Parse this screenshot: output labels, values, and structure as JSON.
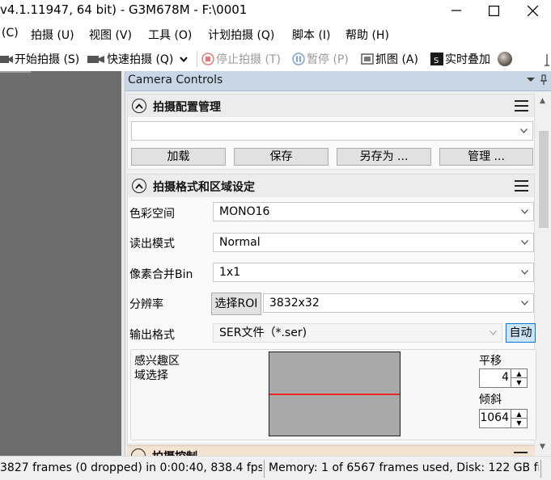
{
  "window": {
    "title": "v4.1.11947, 64 bit) - G3M678M - F:\\0001",
    "controls": [
      "minimize",
      "maximize",
      "close"
    ]
  },
  "menu": [
    "(C)",
    "拍摄 (U)",
    "视图 (V)",
    "工具 (O)",
    "计划拍摄 (Q)",
    "脚本 (I)",
    "帮助 (H)"
  ],
  "toolbar": {
    "start_capture": "开始拍摄 (S)",
    "quick_capture": "快速拍摄 (Q)",
    "stop_capture": "停止拍摄 (T)",
    "pause": "暂停 (P)",
    "grab": "抓图 (A)",
    "live_stack": "实时叠加"
  },
  "panel": {
    "title": "Camera Controls",
    "profile_section": {
      "title": "拍摄配置管理",
      "profile_value": "",
      "buttons": [
        "加载",
        "保存",
        "另存为 ...",
        "管理 ..."
      ]
    },
    "format_section": {
      "title": "拍摄格式和区域设定",
      "color_space_label": "色彩空间",
      "color_space_value": "MONO16",
      "readout_label": "读出模式",
      "readout_value": "Normal",
      "binning_label": "像素合并Bin",
      "binning_value": "1x1",
      "resolution_label": "分辨率",
      "roi_button": "选择ROI",
      "resolution_value": "3832x32",
      "output_label": "输出格式",
      "output_value": "SER文件（*.ser)",
      "auto_button": "自动",
      "roi_label_line1": "感兴趣区",
      "roi_label_line2": "域选择",
      "pan_label": "平移",
      "pan_value": "4",
      "tilt_label": "倾斜",
      "tilt_value": "1064"
    },
    "next_section_title": "拍摄控制"
  },
  "status": {
    "frames": "3827 frames (0 dropped) in 0:00:40, 838.4 fps",
    "memory": "Memory: 1 of 6567 frames used, Disk: 122 GB fr"
  },
  "colors": {
    "panel_header": "#c9d6e6",
    "viewer_bg": "#6d6d6d",
    "roi_line": "#e8262c",
    "auto_button_bg": "#cce4f7"
  }
}
